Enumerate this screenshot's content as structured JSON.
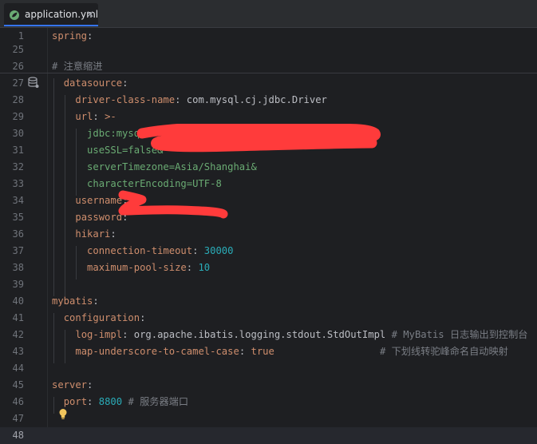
{
  "tab": {
    "filename": "application.yml",
    "close_glyph": "✕"
  },
  "colors": {
    "key": "#cf8e6d",
    "string": "#6aab73",
    "number": "#2aacb8",
    "comment": "#7a7e85",
    "text": "#bcbec4",
    "redaction": "#ff3b3b"
  },
  "lines": [
    {
      "n": "1",
      "parts": [
        [
          "k",
          "spring"
        ],
        [
          "t",
          ":"
        ]
      ]
    },
    {
      "n": "25",
      "parts": []
    },
    {
      "n": "26",
      "parts": [
        [
          "cm",
          "# 注意缩进"
        ]
      ]
    },
    {
      "n": "27",
      "parts": [
        [
          "t",
          "  "
        ],
        [
          "k",
          "datasource"
        ],
        [
          "t",
          ":"
        ]
      ]
    },
    {
      "n": "28",
      "parts": [
        [
          "t",
          "    "
        ],
        [
          "k",
          "driver-class-name"
        ],
        [
          "t",
          ": com.mysql.cj.jdbc.Driver"
        ]
      ]
    },
    {
      "n": "29",
      "parts": [
        [
          "t",
          "    "
        ],
        [
          "k",
          "url"
        ],
        [
          "t",
          ": "
        ],
        [
          "k",
          ">-"
        ]
      ]
    },
    {
      "n": "30",
      "parts": [
        [
          "t",
          "      "
        ],
        [
          "sv",
          "jdbc:mysql"
        ]
      ]
    },
    {
      "n": "31",
      "parts": [
        [
          "t",
          "      "
        ],
        [
          "sv",
          "useSSL=false&"
        ]
      ]
    },
    {
      "n": "32",
      "parts": [
        [
          "t",
          "      "
        ],
        [
          "sv",
          "serverTimezone=Asia/Shanghai&"
        ]
      ]
    },
    {
      "n": "33",
      "parts": [
        [
          "t",
          "      "
        ],
        [
          "sv",
          "characterEncoding=UTF-8"
        ]
      ]
    },
    {
      "n": "34",
      "parts": [
        [
          "t",
          "    "
        ],
        [
          "k",
          "username"
        ],
        [
          "t",
          ":"
        ]
      ]
    },
    {
      "n": "35",
      "parts": [
        [
          "t",
          "    "
        ],
        [
          "k",
          "password"
        ],
        [
          "t",
          ":"
        ]
      ]
    },
    {
      "n": "36",
      "parts": [
        [
          "t",
          "    "
        ],
        [
          "k",
          "hikari"
        ],
        [
          "t",
          ":"
        ]
      ]
    },
    {
      "n": "37",
      "parts": [
        [
          "t",
          "      "
        ],
        [
          "k",
          "connection-timeout"
        ],
        [
          "t",
          ": "
        ],
        [
          "num",
          "30000"
        ]
      ]
    },
    {
      "n": "38",
      "parts": [
        [
          "t",
          "      "
        ],
        [
          "k",
          "maximum-pool-size"
        ],
        [
          "t",
          ": "
        ],
        [
          "num",
          "10"
        ]
      ]
    },
    {
      "n": "39",
      "parts": []
    },
    {
      "n": "40",
      "parts": [
        [
          "k",
          "mybatis"
        ],
        [
          "t",
          ":"
        ]
      ]
    },
    {
      "n": "41",
      "parts": [
        [
          "t",
          "  "
        ],
        [
          "k",
          "configuration"
        ],
        [
          "t",
          ":"
        ]
      ]
    },
    {
      "n": "42",
      "parts": [
        [
          "t",
          "    "
        ],
        [
          "k",
          "log-impl"
        ],
        [
          "t",
          ": org.apache.ibatis.logging.stdout.StdOutImpl "
        ],
        [
          "cm",
          "# MyBatis 日志输出到控制台"
        ]
      ]
    },
    {
      "n": "43",
      "parts": [
        [
          "t",
          "    "
        ],
        [
          "k",
          "map-underscore-to-camel-case"
        ],
        [
          "t",
          ": "
        ],
        [
          "k",
          "true"
        ],
        [
          "t",
          "                  "
        ],
        [
          "cm",
          "# 下划线转驼峰命名自动映射"
        ]
      ]
    },
    {
      "n": "44",
      "parts": []
    },
    {
      "n": "45",
      "parts": [
        [
          "k",
          "server"
        ],
        [
          "t",
          ":"
        ]
      ]
    },
    {
      "n": "46",
      "parts": [
        [
          "t",
          "  "
        ],
        [
          "k",
          "port"
        ],
        [
          "t",
          ": "
        ],
        [
          "num",
          "8800"
        ],
        [
          "t",
          " "
        ],
        [
          "cm",
          "# 服务器端口"
        ]
      ]
    },
    {
      "n": "47",
      "parts": []
    },
    {
      "n": "48",
      "parts": []
    }
  ]
}
